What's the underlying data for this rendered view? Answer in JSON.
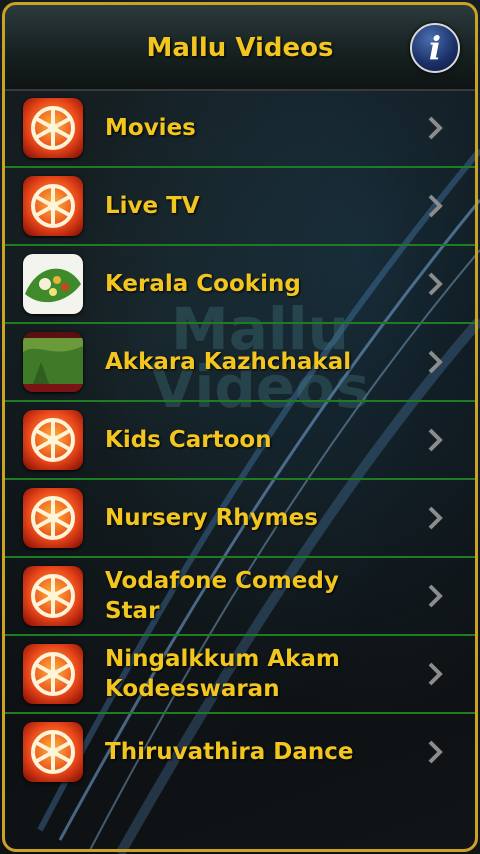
{
  "header": {
    "title": "Mallu Videos",
    "info_icon": "info-icon"
  },
  "watermark": {
    "line1": "Mallu",
    "line2": "Videos"
  },
  "colors": {
    "accent": "#f2c61f",
    "divider": "#1e7d22",
    "frame": "#c9a227"
  },
  "menu": {
    "items": [
      {
        "label": "Movies",
        "icon": "film-reel-icon"
      },
      {
        "label": "Live TV",
        "icon": "film-reel-icon"
      },
      {
        "label": "Kerala Cooking",
        "icon": "banana-leaf-meal-icon"
      },
      {
        "label": "Akkara Kazhchakal",
        "icon": "landscape-thumbnail-icon"
      },
      {
        "label": "Kids Cartoon",
        "icon": "film-reel-icon"
      },
      {
        "label": "Nursery Rhymes",
        "icon": "film-reel-icon"
      },
      {
        "label": "Vodafone Comedy Star",
        "icon": "film-reel-icon"
      },
      {
        "label": "Ningalkkum Akam Kodeeswaran",
        "icon": "film-reel-icon"
      },
      {
        "label": "Thiruvathira Dance",
        "icon": "film-reel-icon"
      }
    ]
  }
}
